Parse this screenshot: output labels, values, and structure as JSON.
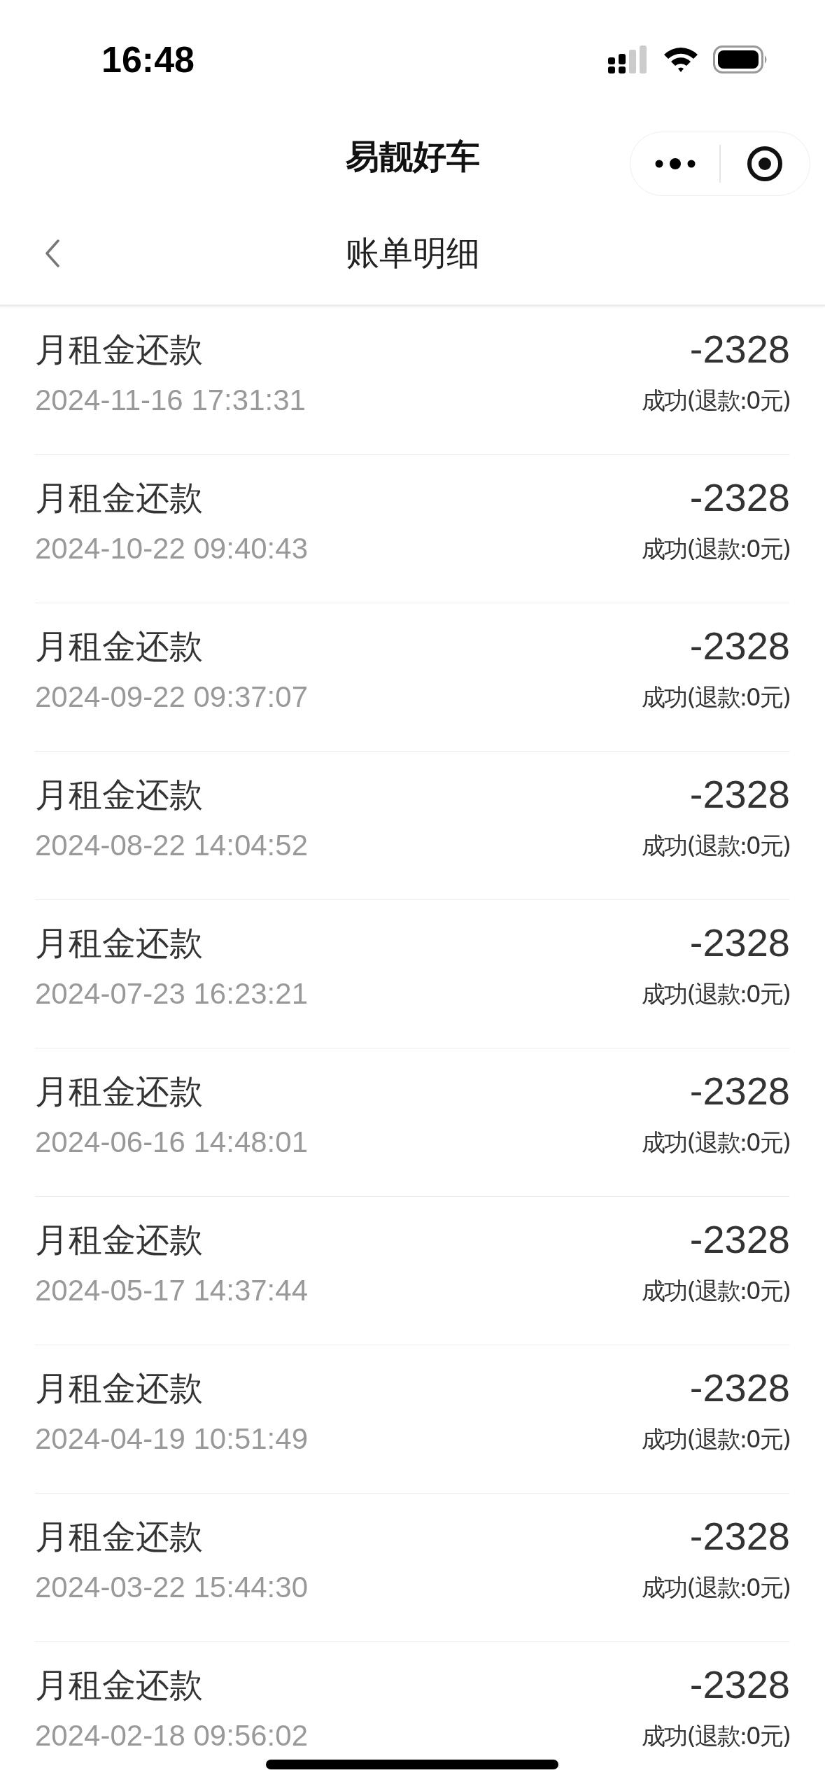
{
  "status_bar": {
    "time": "16:48"
  },
  "mini_program_bar": {
    "title": "易靓好车"
  },
  "header": {
    "title": "账单明细"
  },
  "records": [
    {
      "title": "月租金还款",
      "time": "2024-11-16 17:31:31",
      "amount": "-2328",
      "status": "成功(退款:0元)"
    },
    {
      "title": "月租金还款",
      "time": "2024-10-22 09:40:43",
      "amount": "-2328",
      "status": "成功(退款:0元)"
    },
    {
      "title": "月租金还款",
      "time": "2024-09-22 09:37:07",
      "amount": "-2328",
      "status": "成功(退款:0元)"
    },
    {
      "title": "月租金还款",
      "time": "2024-08-22 14:04:52",
      "amount": "-2328",
      "status": "成功(退款:0元)"
    },
    {
      "title": "月租金还款",
      "time": "2024-07-23 16:23:21",
      "amount": "-2328",
      "status": "成功(退款:0元)"
    },
    {
      "title": "月租金还款",
      "time": "2024-06-16 14:48:01",
      "amount": "-2328",
      "status": "成功(退款:0元)"
    },
    {
      "title": "月租金还款",
      "time": "2024-05-17 14:37:44",
      "amount": "-2328",
      "status": "成功(退款:0元)"
    },
    {
      "title": "月租金还款",
      "time": "2024-04-19 10:51:49",
      "amount": "-2328",
      "status": "成功(退款:0元)"
    },
    {
      "title": "月租金还款",
      "time": "2024-03-22 15:44:30",
      "amount": "-2328",
      "status": "成功(退款:0元)"
    },
    {
      "title": "月租金还款",
      "time": "2024-02-18 09:56:02",
      "amount": "-2328",
      "status": "成功(退款:0元)"
    }
  ]
}
